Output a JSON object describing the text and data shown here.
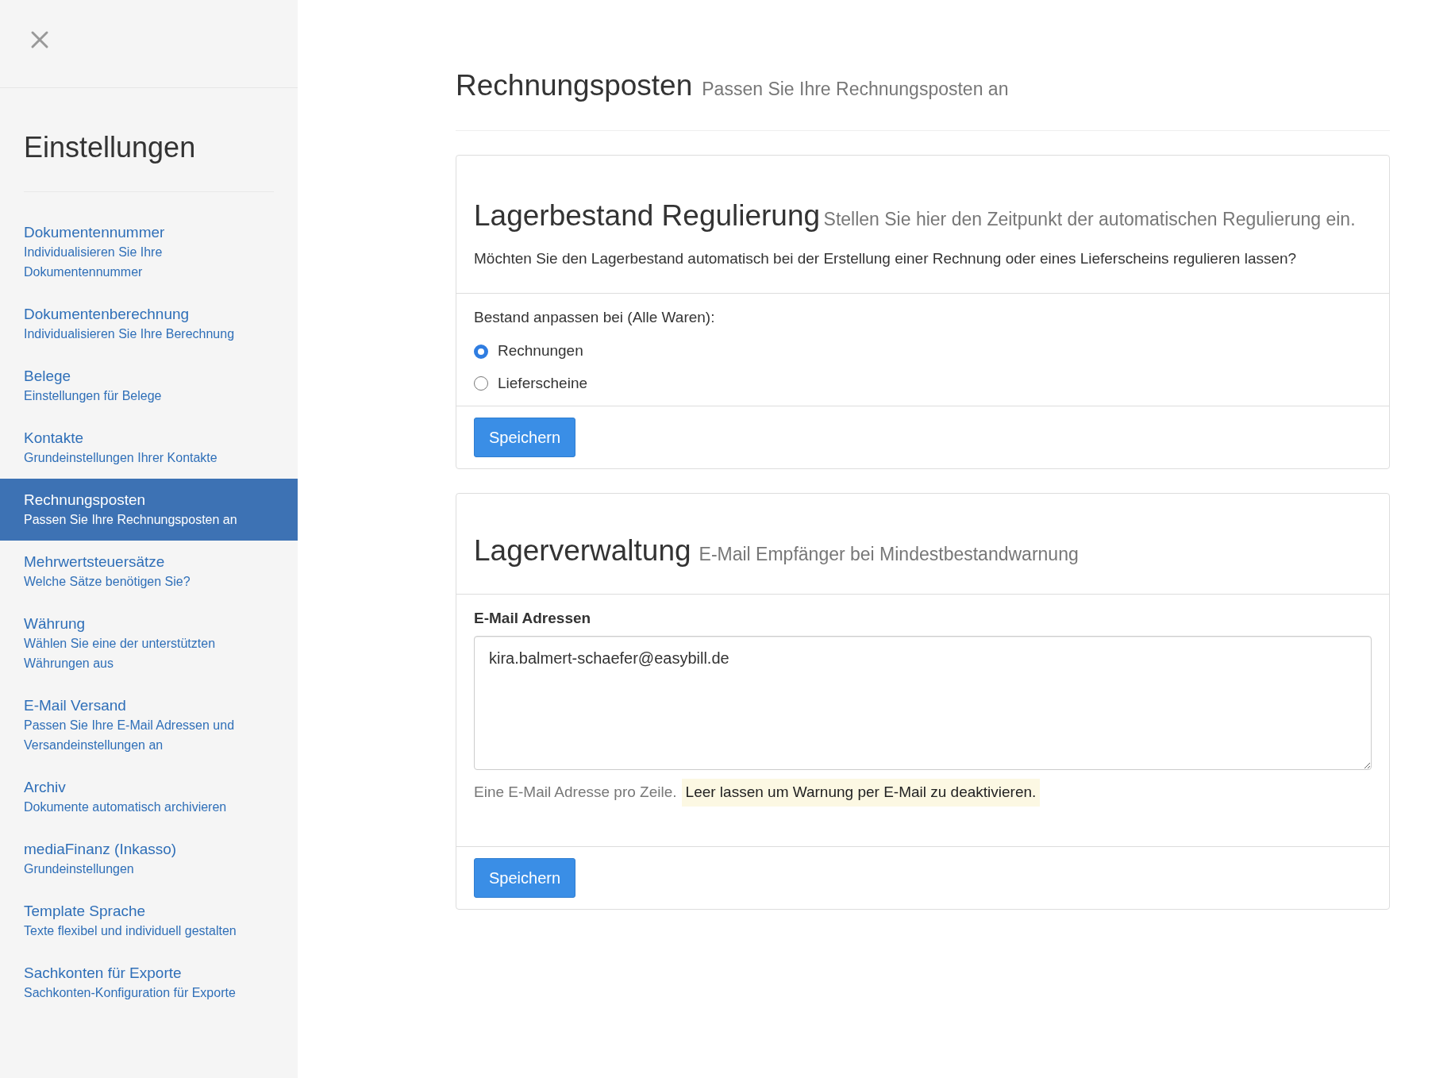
{
  "sidebar": {
    "title": "Einstellungen",
    "items": [
      {
        "title": "Dokumentennummer",
        "subtitle": "Individualisieren Sie Ihre Dokumentennummer",
        "selected": false
      },
      {
        "title": "Dokumentenberechnung",
        "subtitle": "Individualisieren Sie Ihre Berechnung",
        "selected": false
      },
      {
        "title": "Belege",
        "subtitle": "Einstellungen für Belege",
        "selected": false
      },
      {
        "title": "Kontakte",
        "subtitle": "Grundeinstellungen Ihrer Kontakte",
        "selected": false
      },
      {
        "title": "Rechnungsposten",
        "subtitle": "Passen Sie Ihre Rechnungsposten an",
        "selected": true
      },
      {
        "title": "Mehrwertsteuersätze",
        "subtitle": "Welche Sätze benötigen Sie?",
        "selected": false
      },
      {
        "title": "Währung",
        "subtitle": "Wählen Sie eine der unterstützten Währungen aus",
        "selected": false
      },
      {
        "title": "E-Mail Versand",
        "subtitle": "Passen Sie Ihre E-Mail Adressen und Versandeinstellungen an",
        "selected": false
      },
      {
        "title": "Archiv",
        "subtitle": "Dokumente automatisch archivieren",
        "selected": false
      },
      {
        "title": "mediaFinanz (Inkasso)",
        "subtitle": "Grundeinstellungen",
        "selected": false
      },
      {
        "title": "Template Sprache",
        "subtitle": "Texte flexibel und individuell gestalten",
        "selected": false
      },
      {
        "title": "Sachkonten für Exporte",
        "subtitle": "Sachkonten-Konfiguration für Exporte",
        "selected": false
      }
    ]
  },
  "page": {
    "title": "Rechnungsposten",
    "subtitle": "Passen Sie Ihre Rechnungsposten an"
  },
  "stock_regulation": {
    "title": "Lagerbestand Regulierung",
    "subtitle": "Stellen Sie hier den Zeitpunkt der automatischen Regulierung ein.",
    "question": "Möchten Sie den Lagerbestand automatisch bei der Erstellung einer Rechnung oder eines Lieferscheins regulieren lassen?",
    "group_label": "Bestand anpassen bei (Alle Waren):",
    "options": [
      {
        "label": "Rechnungen",
        "selected": true
      },
      {
        "label": "Lieferscheine",
        "selected": false
      }
    ],
    "save_button": "Speichern"
  },
  "stock_management": {
    "title": "Lagerverwaltung",
    "subtitle": "E-Mail Empfänger bei Mindestbestandwarnung",
    "field_label": "E-Mail Adressen",
    "value": "kira.balmert-schaefer@easybill.de",
    "help_text": "Eine E-Mail Adresse pro Zeile.",
    "help_highlight": "Leer lassen um Warnung per E-Mail zu deaktivieren.",
    "save_button": "Speichern"
  }
}
